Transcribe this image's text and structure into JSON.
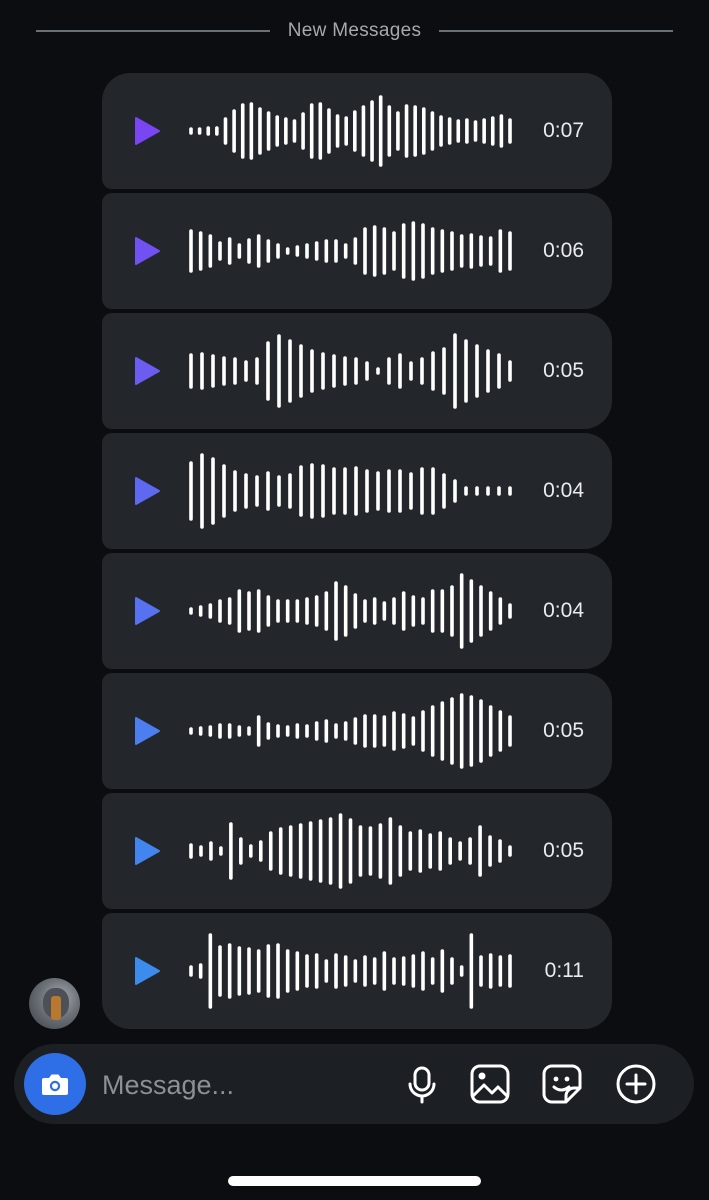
{
  "divider": {
    "label": "New Messages"
  },
  "colors": {
    "bubble": "#23262b",
    "wave": "#ffffff",
    "play_gradient": [
      "#7a45f2",
      "#7251f2",
      "#6c5cf0",
      "#5f68f0",
      "#5672f0",
      "#4c7ef0",
      "#4385ef",
      "#3c8cee"
    ],
    "camera_button": "#2e6ee6",
    "background": "#0b0d10"
  },
  "voice_messages": [
    {
      "duration": "0:07",
      "play_icon": "play-icon",
      "waveform": [
        2,
        2,
        3,
        3,
        12,
        20,
        26,
        27,
        22,
        18,
        14,
        12,
        10,
        17,
        26,
        27,
        21,
        15,
        13,
        19,
        24,
        29,
        34,
        24,
        18,
        25,
        24,
        22,
        18,
        14,
        12,
        10,
        11,
        9,
        11,
        13,
        15,
        11
      ]
    },
    {
      "duration": "0:06",
      "play_icon": "play-icon",
      "waveform": [
        20,
        18,
        15,
        8,
        12,
        6,
        11,
        15,
        10,
        6,
        2,
        4,
        6,
        8,
        10,
        10,
        6,
        12,
        22,
        24,
        22,
        18,
        26,
        28,
        26,
        22,
        20,
        18,
        15,
        16,
        14,
        13,
        20,
        18
      ]
    },
    {
      "duration": "0:05",
      "play_icon": "play-icon",
      "waveform": [
        16,
        17,
        15,
        13,
        12,
        9,
        12,
        28,
        35,
        30,
        25,
        20,
        17,
        15,
        13,
        12,
        8,
        2,
        12,
        16,
        8,
        12,
        18,
        22,
        36,
        30,
        25,
        20,
        16,
        9
      ]
    },
    {
      "duration": "0:04",
      "play_icon": "play-icon",
      "waveform": [
        28,
        36,
        32,
        25,
        19,
        16,
        14,
        18,
        14,
        16,
        24,
        26,
        25,
        22,
        22,
        23,
        20,
        18,
        20,
        20,
        17,
        22,
        22,
        16,
        10,
        3,
        3,
        3,
        3,
        3
      ]
    },
    {
      "duration": "0:04",
      "play_icon": "play-icon",
      "waveform": [
        2,
        4,
        6,
        10,
        12,
        20,
        18,
        20,
        14,
        10,
        10,
        10,
        12,
        14,
        18,
        28,
        24,
        16,
        10,
        12,
        8,
        12,
        18,
        14,
        12,
        20,
        20,
        24,
        36,
        30,
        24,
        18,
        12,
        6
      ]
    },
    {
      "duration": "0:05",
      "play_icon": "play-icon",
      "waveform": [
        2,
        3,
        4,
        6,
        6,
        4,
        3,
        14,
        7,
        5,
        4,
        6,
        5,
        8,
        10,
        6,
        8,
        12,
        15,
        15,
        14,
        18,
        16,
        13,
        19,
        24,
        28,
        32,
        36,
        34,
        30,
        24,
        19,
        14
      ]
    },
    {
      "duration": "0:05",
      "play_icon": "play-icon",
      "waveform": [
        6,
        4,
        8,
        3,
        27,
        12,
        5,
        9,
        18,
        22,
        24,
        26,
        28,
        30,
        32,
        36,
        31,
        24,
        23,
        26,
        32,
        24,
        18,
        20,
        16,
        18,
        12,
        8,
        12,
        24,
        14,
        10,
        4
      ]
    },
    {
      "duration": "0:11",
      "play_icon": "play-icon",
      "waveform": [
        4,
        6,
        36,
        24,
        26,
        23,
        22,
        20,
        25,
        26,
        20,
        18,
        15,
        16,
        10,
        16,
        14,
        10,
        14,
        12,
        18,
        12,
        13,
        15,
        18,
        12,
        20,
        12,
        4,
        36,
        14,
        16,
        14,
        15
      ]
    }
  ],
  "composer": {
    "placeholder": "Message...",
    "camera_icon": "camera-icon",
    "tools": [
      "microphone-icon",
      "gallery-icon",
      "sticker-icon",
      "plus-circle-icon"
    ]
  }
}
